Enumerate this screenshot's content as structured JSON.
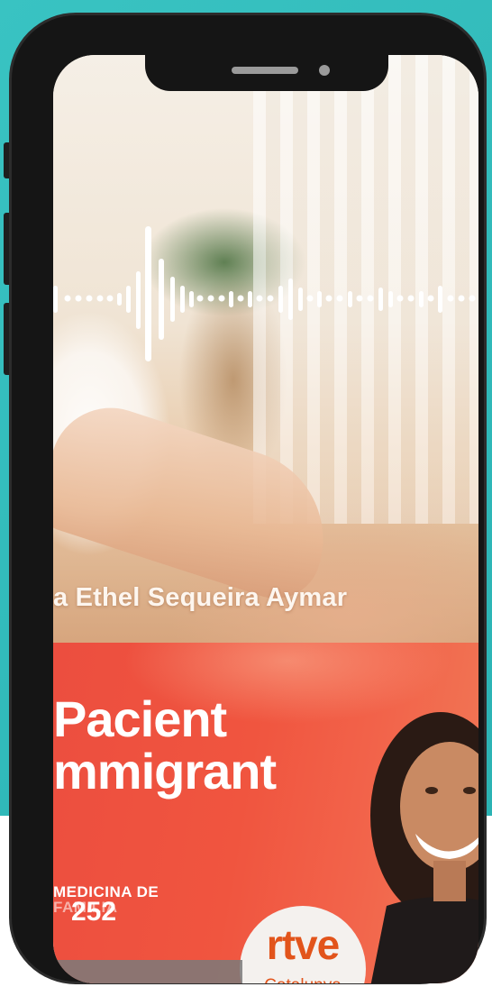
{
  "video": {
    "speaker_name": "a Ethel Sequeira Aymar",
    "waveform": "audio-waveform"
  },
  "cover": {
    "title": "Pacient\nmmigrant",
    "series_label": "MEDICINA DE\nFAMILIA",
    "episode_number": "252",
    "logo": {
      "brand": "rtve",
      "sub": "Catalunya"
    }
  },
  "colors": {
    "background_accent": "#39c3c2",
    "cover_red": "#ec4e3f",
    "logo_orange": "#e2541b"
  }
}
